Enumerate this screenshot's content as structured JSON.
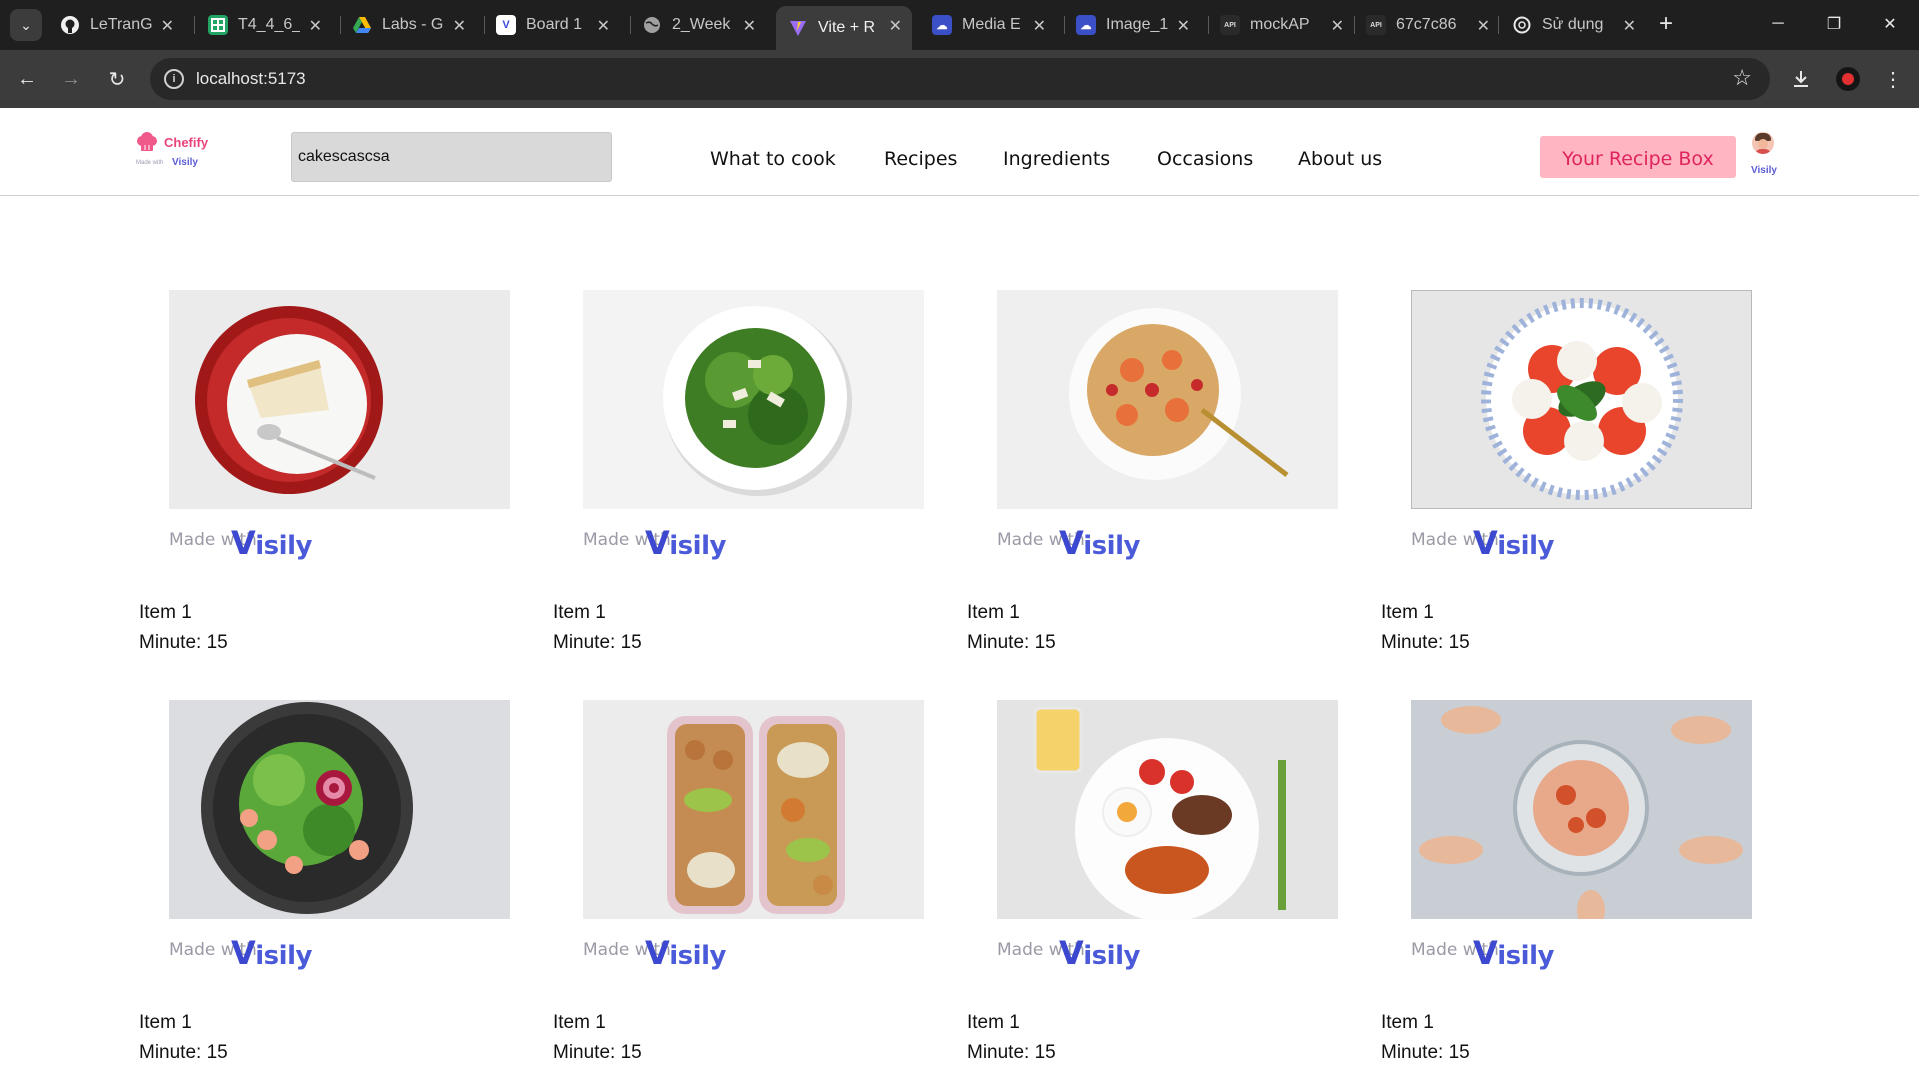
{
  "browser": {
    "tabs": [
      {
        "title": "LeTranGi",
        "icon": "github-icon"
      },
      {
        "title": "T4_4_6_",
        "icon": "sheets-icon"
      },
      {
        "title": "Labs - G",
        "icon": "drive-icon"
      },
      {
        "title": "Board 1",
        "icon": "visily-icon"
      },
      {
        "title": "2_Week",
        "icon": "globe-icon"
      },
      {
        "title": "Vite + R",
        "icon": "vite-icon",
        "active": true
      },
      {
        "title": "Media E",
        "icon": "cloud-icon"
      },
      {
        "title": "Image_1",
        "icon": "cloud-icon"
      },
      {
        "title": "mockAP",
        "icon": "mockapi-icon"
      },
      {
        "title": "67c7c86",
        "icon": "mockapi-icon"
      },
      {
        "title": "Sử dụng",
        "icon": "openai-icon"
      }
    ],
    "url": "localhost:5173"
  },
  "header": {
    "brand_name": "Chefify",
    "brand_made_with": "Made with",
    "brand_visily": "Visily",
    "search_value": "cakescascsa",
    "nav": [
      "What to cook",
      "Recipes",
      "Ingredients",
      "Occasions",
      "About us"
    ],
    "cta": "Your Recipe Box",
    "avatar_visily": "Visily"
  },
  "cards": [
    {
      "name": "Item 1",
      "minute": "Minute: 15",
      "photo": "cheesecake-plate"
    },
    {
      "name": "Item 1",
      "minute": "Minute: 15",
      "photo": "green-salad"
    },
    {
      "name": "Item 1",
      "minute": "Minute: 15",
      "photo": "shrimp-pasta"
    },
    {
      "name": "Item 1",
      "minute": "Minute: 15",
      "photo": "caprese"
    },
    {
      "name": "Item 1",
      "minute": "Minute: 15",
      "photo": "shrimp-salad"
    },
    {
      "name": "Item 1",
      "minute": "Minute: 15",
      "photo": "meal-prep-boxes"
    },
    {
      "name": "Item 1",
      "minute": "Minute: 15",
      "photo": "english-breakfast"
    },
    {
      "name": "Item 1",
      "minute": "Minute: 15",
      "photo": "shared-platter"
    }
  ],
  "made_with": "Made with",
  "visily": "isily",
  "visily_v": "V"
}
